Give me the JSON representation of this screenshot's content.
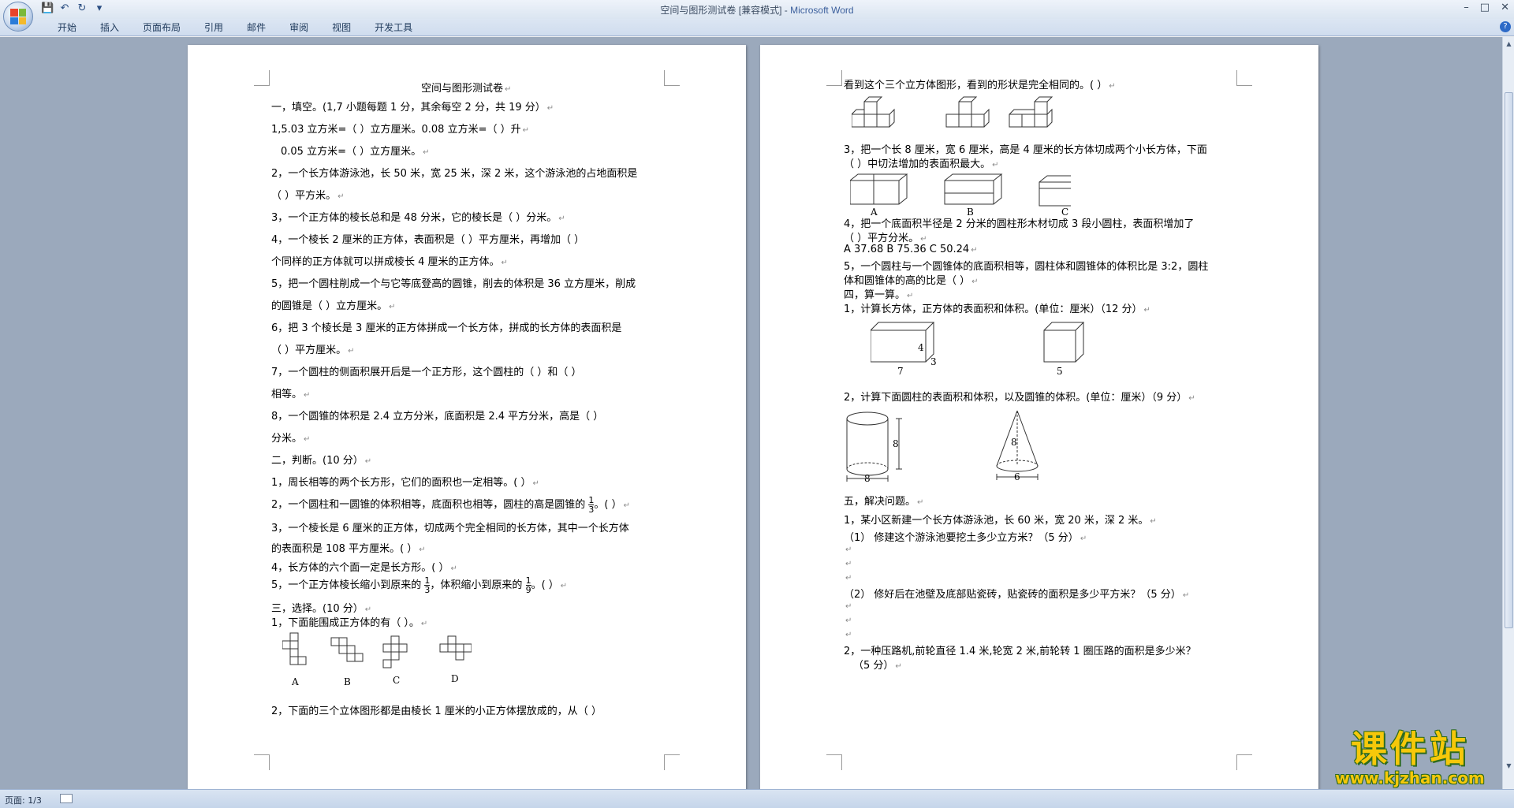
{
  "window": {
    "title": "空间与图形测试卷 [兼容模式] - ",
    "app_name": "Microsoft Word"
  },
  "quick_access": {
    "save_icon": "save-icon",
    "undo_icon": "undo-icon",
    "redo_icon": "redo-icon",
    "customize_icon": "dropdown-icon"
  },
  "ribbon": {
    "tabs": [
      "开始",
      "插入",
      "页面布局",
      "引用",
      "邮件",
      "审阅",
      "视图",
      "开发工具"
    ]
  },
  "page1": {
    "title": "空间与图形测试卷",
    "lines": [
      "一，填空。(1,7 小题每题 1 分，其余每空 2 分，共 19 分）",
      "1,5.03 立方米=（        ）立方厘米。0.08 立方米=（          ）升",
      "0.05 立方米=（          ）立方厘米。",
      "2，一个长方体游泳池，长 50 米，宽 25 米，深 2 米，这个游泳池的占地面积是",
      "（          ）平方米。",
      "3，一个正方体的棱长总和是 48 分米，它的棱长是（          ）分米。",
      "4，一个棱长 2 厘米的正方体，表面积是（            ）平方厘米，再增加（        ）",
      "个同样的正方体就可以拼成棱长 4 厘米的正方体。",
      "5，把一个圆柱削成一个与它等底登高的圆锥，削去的体积是 36 立方厘米，削成",
      "的圆锥是（          ）立方厘米。",
      "6，把  3  个棱长是  3  厘米的正方体拼成一个长方体，拼成的长方体的表面积是",
      "（          ）平方厘米。",
      "7，一个圆柱的侧面积展开后是一个正方形，这个圆柱的（          ）和（          ）",
      "相等。",
      "8，一个圆锥的体积是 2.4 立方分米，底面积是 2.4 平方分米，高是（          ）",
      "分米。",
      "二，判断。(10 分）",
      "1，周长相等的两个长方形，它们的面积也一定相等。(              ）",
      "2，一个圆柱和一圆锥的体积相等，底面积也相等，圆柱的高是圆锥的",
      "3，一个棱长是 6 厘米的正方体，切成两个完全相同的长方体，其中一个长方体",
      "的表面积是 108 平方厘米。(              ）",
      "4，长方体的六个面一定是长方形。(              ）",
      "5，一个正方体棱长缩小到原来的",
      "三，选择。(10 分）",
      "1，下面能围成正方体的有（            ）。",
      "2，下面的三个立体图形都是由棱长 1 厘米的小正方体摆放成的，从（          ）"
    ],
    "fraction_1_3_num": "1",
    "fraction_1_3_den": "3",
    "q2_tail": "。(        ）",
    "q5_mid": "，体积缩小到原来的",
    "fraction_1_9_num": "1",
    "fraction_1_9_den": "9",
    "q5_tail": "。(          ）",
    "net_labels": [
      "A",
      "B",
      "C",
      "D"
    ]
  },
  "page2": {
    "lines": [
      "看到这个三个立方体图形，看到的形状是完全相同的。(            ）",
      "3，把一个长 8 厘米，宽 6 厘米，高是 4 厘米的长方体切成两个小长方体，下面",
      "（          ）中切法增加的表面积最大。",
      "4，把一个底面积半径是  2  分米的圆柱形木材切成  3  段小圆柱，表面积增加了",
      "（        ）平方分米。",
      "A     37.68          B     75.36      C     50.24",
      "5，一个圆柱与一个圆锥体的底面积相等，圆柱体和圆锥体的体积比是 3:2，圆柱",
      "体和圆锥体的高的比是（            ）",
      "四，算一算。",
      "1，计算长方体，正方体的表面积和体积。(单位：厘米）（12 分）",
      "2，计算下面圆柱的表面积和体积，以及圆锥的体积。(单位：厘米）（9 分）",
      "五，解决问题。",
      "1，某小区新建一个长方体游泳池，长 60 米，宽 20 米，深 2 米。",
      "（1）  修建这个游泳池要挖土多少立方米？（5 分）",
      "（2）  修好后在池壁及底部贴瓷砖，贴瓷砖的面积是多少平方米？（5 分）",
      "2，一种压路机,前轮直径 1.4 米,轮宽 2 米,前轮转 1 圈压路的面积是多少米？",
      "（5 分）"
    ],
    "cut_labels": [
      "A",
      "B",
      "C"
    ],
    "cuboid_dims": [
      "4",
      "3",
      "7"
    ],
    "cube_dim": "5",
    "cylinder_dims": [
      "8",
      "8"
    ],
    "cone_dims": [
      "8",
      "6"
    ]
  },
  "statusbar": {
    "page_info": "页面: 1/3"
  },
  "watermark": {
    "text": "课件站",
    "url": "www.kjzhan.com"
  }
}
